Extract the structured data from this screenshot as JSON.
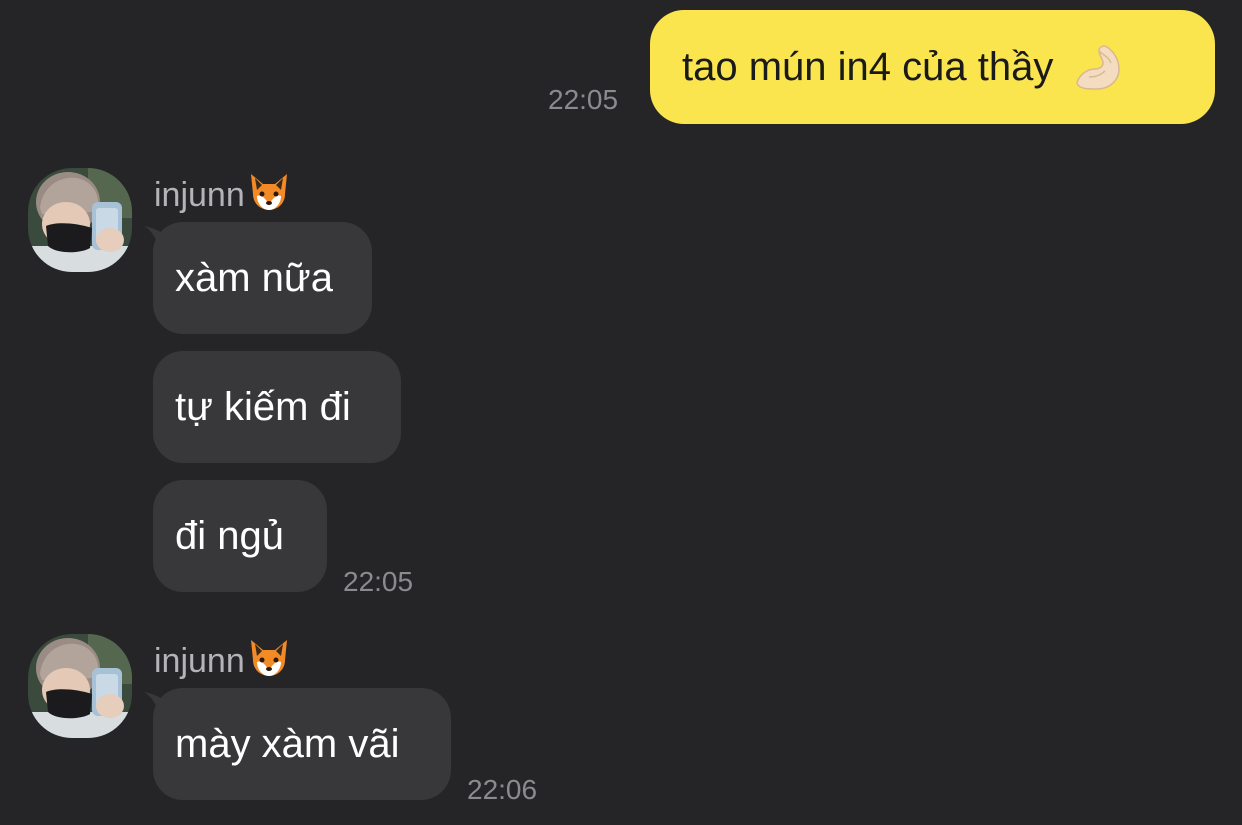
{
  "messages": {
    "outgoing_1": {
      "text": "tao mún in4 của thầy",
      "emoji": "🤌",
      "time": "22:05"
    },
    "group_1": {
      "sender": "injunn",
      "sender_emoji": "🦊",
      "bubbles": [
        "xàm nữa",
        "tự kiếm đi",
        "đi ngủ"
      ],
      "time": "22:05"
    },
    "group_2": {
      "sender": "injunn",
      "sender_emoji": "🦊",
      "bubbles": [
        "mày xàm vãi"
      ],
      "time": "22:06"
    }
  },
  "colors": {
    "background": "#252527",
    "outgoing_bubble": "#fae54e",
    "incoming_bubble": "#38383b",
    "timestamp": "#8a8a8f"
  },
  "icons": [
    "avatar-photo",
    "fox-emoji",
    "pinched-fingers-emoji"
  ]
}
